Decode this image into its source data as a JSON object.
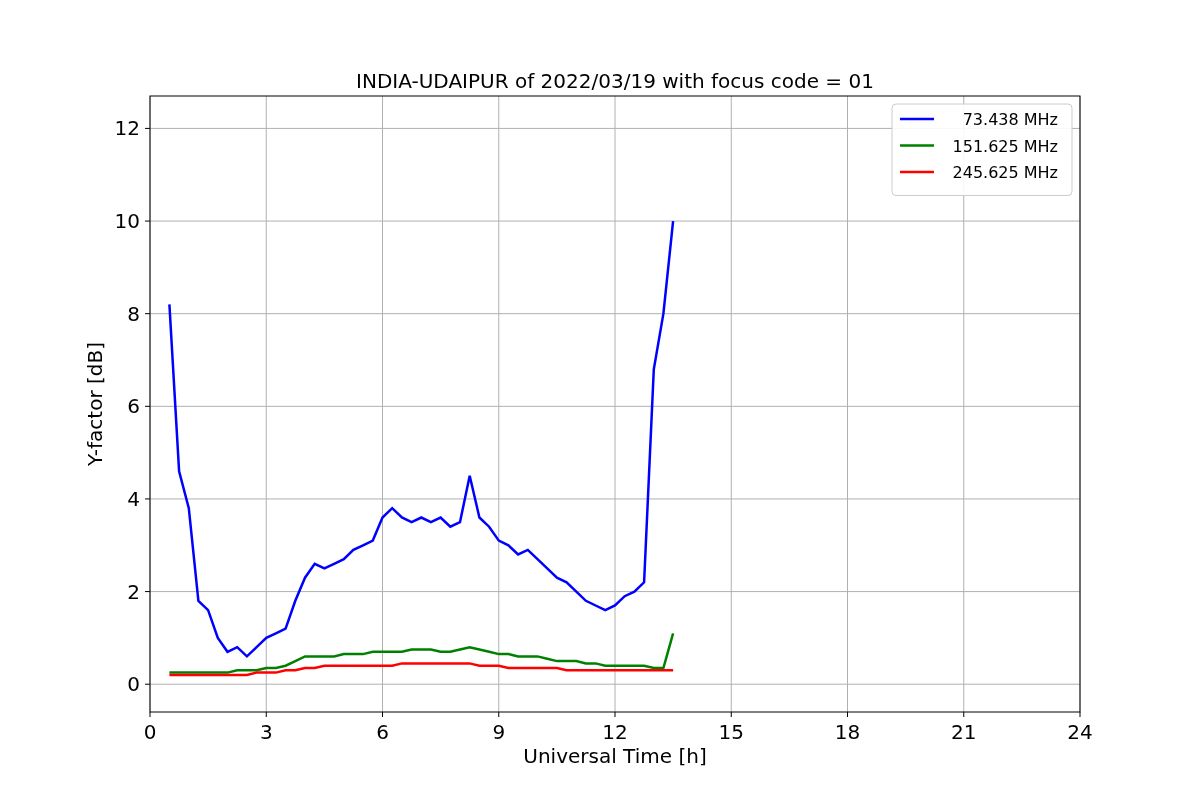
{
  "chart_data": {
    "type": "line",
    "title": "INDIA-UDAIPUR of 2022/03/19 with focus code = 01",
    "xlabel": "Universal Time [h]",
    "ylabel": "Y-factor [dB]",
    "x": [
      0.5,
      0.75,
      1.0,
      1.25,
      1.5,
      1.75,
      2.0,
      2.25,
      2.5,
      2.75,
      3.0,
      3.25,
      3.5,
      3.75,
      4.0,
      4.25,
      4.5,
      4.75,
      5.0,
      5.25,
      5.5,
      5.75,
      6.0,
      6.25,
      6.5,
      6.75,
      7.0,
      7.25,
      7.5,
      7.75,
      8.0,
      8.25,
      8.5,
      8.75,
      9.0,
      9.25,
      9.5,
      9.75,
      10.0,
      10.25,
      10.5,
      10.75,
      11.0,
      11.25,
      11.5,
      11.75,
      12.0,
      12.25,
      12.5,
      12.75,
      13.0,
      13.25,
      13.5
    ],
    "series": [
      {
        "name": "73.438 MHz",
        "color": "#0000ff",
        "values": [
          8.2,
          4.6,
          3.8,
          1.8,
          1.6,
          1.0,
          0.7,
          0.8,
          0.6,
          0.8,
          1.0,
          1.1,
          1.2,
          1.8,
          2.3,
          2.6,
          2.5,
          2.6,
          2.7,
          2.9,
          3.0,
          3.1,
          3.6,
          3.8,
          3.6,
          3.5,
          3.6,
          3.5,
          3.6,
          3.4,
          3.5,
          4.5,
          3.6,
          3.4,
          3.1,
          3.0,
          2.8,
          2.9,
          2.7,
          2.5,
          2.3,
          2.2,
          2.0,
          1.8,
          1.7,
          1.6,
          1.7,
          1.9,
          2.0,
          2.2,
          6.8,
          8.0,
          10.0
        ]
      },
      {
        "name": "151.625 MHz",
        "color": "#008000",
        "values": [
          0.25,
          0.25,
          0.25,
          0.25,
          0.25,
          0.25,
          0.25,
          0.3,
          0.3,
          0.3,
          0.35,
          0.35,
          0.4,
          0.5,
          0.6,
          0.6,
          0.6,
          0.6,
          0.65,
          0.65,
          0.65,
          0.7,
          0.7,
          0.7,
          0.7,
          0.75,
          0.75,
          0.75,
          0.7,
          0.7,
          0.75,
          0.8,
          0.75,
          0.7,
          0.65,
          0.65,
          0.6,
          0.6,
          0.6,
          0.55,
          0.5,
          0.5,
          0.5,
          0.45,
          0.45,
          0.4,
          0.4,
          0.4,
          0.4,
          0.4,
          0.35,
          0.35,
          1.1
        ]
      },
      {
        "name": "245.625 MHz",
        "color": "#ff0000",
        "values": [
          0.2,
          0.2,
          0.2,
          0.2,
          0.2,
          0.2,
          0.2,
          0.2,
          0.2,
          0.25,
          0.25,
          0.25,
          0.3,
          0.3,
          0.35,
          0.35,
          0.4,
          0.4,
          0.4,
          0.4,
          0.4,
          0.4,
          0.4,
          0.4,
          0.45,
          0.45,
          0.45,
          0.45,
          0.45,
          0.45,
          0.45,
          0.45,
          0.4,
          0.4,
          0.4,
          0.35,
          0.35,
          0.35,
          0.35,
          0.35,
          0.35,
          0.3,
          0.3,
          0.3,
          0.3,
          0.3,
          0.3,
          0.3,
          0.3,
          0.3,
          0.3,
          0.3,
          0.3
        ]
      }
    ],
    "grid": true,
    "legend": true,
    "xlim": [
      0,
      24
    ],
    "ylim": [
      -0.6,
      12.7
    ],
    "xticks": [
      0,
      3,
      6,
      9,
      12,
      15,
      18,
      21,
      24
    ],
    "yticks": [
      0,
      2,
      4,
      6,
      8,
      10,
      12
    ]
  }
}
